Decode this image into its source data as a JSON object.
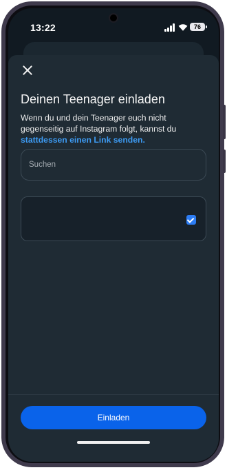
{
  "status_bar": {
    "time": "13:22",
    "battery": "76",
    "icons": [
      "signal-icon",
      "wifi-icon",
      "battery-icon"
    ]
  },
  "dialog": {
    "close_icon": "close-icon",
    "title": "Deinen Teenager einladen",
    "description": "Wenn du und dein Teenager euch nicht gegenseitig auf Instagram folgt, kannst du",
    "link": "stattdessen einen Link senden.",
    "search": {
      "placeholder": "Suchen",
      "value": ""
    },
    "contact": {
      "name": "",
      "selected": true
    },
    "button": "Einladen"
  },
  "colors": {
    "background": "#1f2b34",
    "accent": "#0a63ea",
    "link": "#3d9bf3",
    "checkbox": "#2c7cf3"
  }
}
